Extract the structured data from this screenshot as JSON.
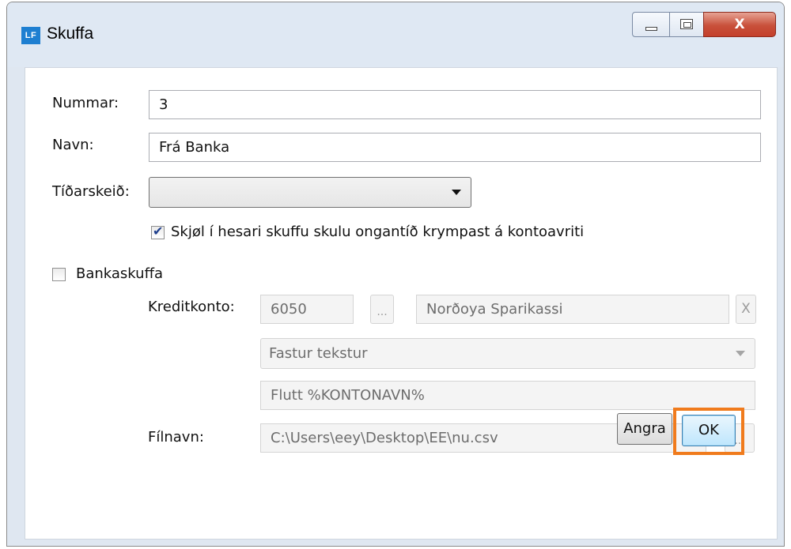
{
  "window": {
    "app_icon_text": "LF",
    "title": "Skuffa",
    "controls": {
      "minimize": "minimize-icon",
      "maximize": "maximize-icon",
      "close_label": "X"
    }
  },
  "form": {
    "number": {
      "label": "Nummar:",
      "value": "3"
    },
    "name": {
      "label": "Navn:",
      "value": "Frá Banka"
    },
    "period": {
      "label": "Tíðarskeið:",
      "value": ""
    },
    "never_shrink": {
      "checked": true,
      "label": "Skjøl í hesari skuffu skulu ongantíð krympast á kontoavriti"
    },
    "bank_drawer": {
      "checked": false,
      "label": "Bankaskuffa"
    },
    "credit_account": {
      "label": "Kreditkonto:",
      "number": "6050",
      "browse_label": "...",
      "name": "Norðoya Sparikassi",
      "clear_label": "X"
    },
    "text_type": {
      "value": "Fastur tekstur"
    },
    "text_value": {
      "value": "Flutt %KONTONAVN%"
    },
    "filename": {
      "label": "Fílnavn:",
      "value": "C:\\Users\\eey\\Desktop\\EE\\nu.csv",
      "browse_label": "..."
    }
  },
  "buttons": {
    "cancel": "Angra",
    "ok": "OK"
  },
  "colors": {
    "highlight": "#f07b1d",
    "checkmark": "#1e3e8c",
    "close_button": "#c4402b"
  }
}
